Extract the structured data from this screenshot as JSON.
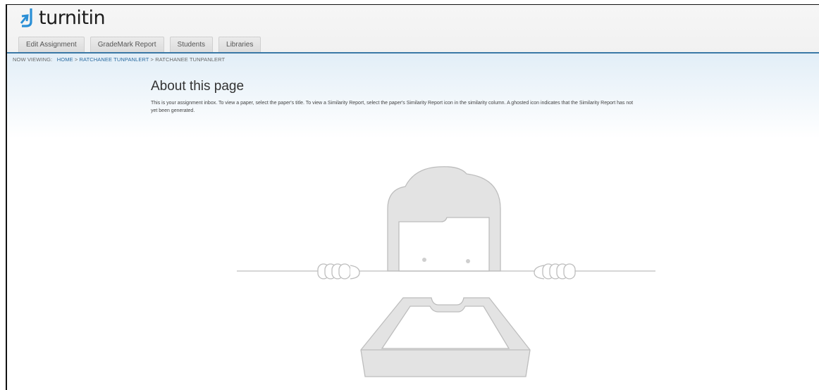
{
  "brand": {
    "name": "turnitin",
    "trademark": "™"
  },
  "tabs": [
    "Edit Assignment",
    "GradeMark Report",
    "Students",
    "Libraries"
  ],
  "breadcrumb": {
    "label": "NOW VIEWING:",
    "home": "HOME",
    "separator": ">",
    "link": "RATCHANEE TUNPANLERT",
    "current": "RATCHANEE TUNPANLERT"
  },
  "about": {
    "title": "About this page",
    "text_line1": "This is your assignment inbox. To view a paper, select the paper's title. To view a Similarity Report, select the paper's Similarity Report icon in the similarity column. A ghosted icon indicates that the Similarity Report has not",
    "text_line2": "yet been generated."
  },
  "colors": {
    "accent": "#3a78a6",
    "logo_icon": "#2a8fd6",
    "illustration_stroke": "#bdbdbd",
    "illustration_fill": "#e3e3e3"
  },
  "icons": {
    "logo": "turnitin-arrow-icon"
  }
}
